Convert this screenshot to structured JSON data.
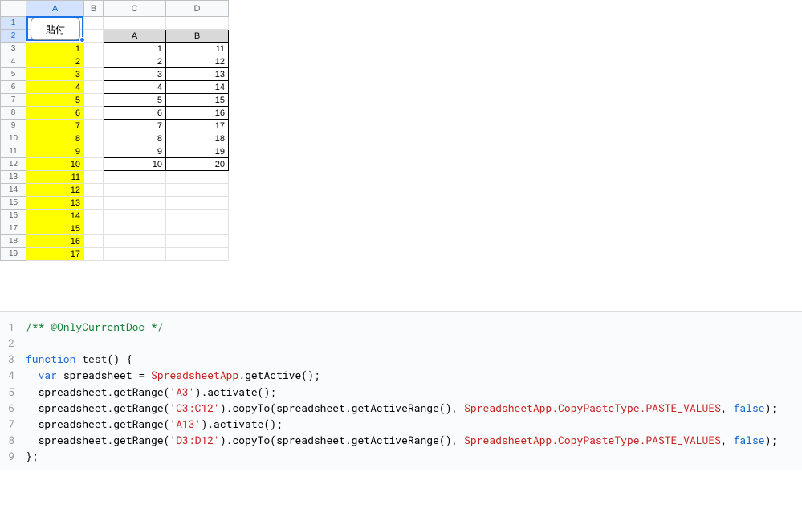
{
  "spreadsheet": {
    "button_label": "貼付",
    "column_headers": [
      "A",
      "B",
      "C",
      "D"
    ],
    "row_headers": [
      "1",
      "2",
      "3",
      "4",
      "5",
      "6",
      "7",
      "8",
      "9",
      "10",
      "11",
      "12",
      "13",
      "14",
      "15",
      "16",
      "17",
      "18",
      "19"
    ],
    "col_a_values": [
      "",
      "",
      "1",
      "2",
      "3",
      "4",
      "5",
      "6",
      "7",
      "8",
      "9",
      "10",
      "11",
      "12",
      "13",
      "14",
      "15",
      "16",
      "17"
    ],
    "inner_headers": [
      "A",
      "B"
    ],
    "inner_rows": [
      [
        "1",
        "11"
      ],
      [
        "2",
        "12"
      ],
      [
        "3",
        "13"
      ],
      [
        "4",
        "14"
      ],
      [
        "5",
        "15"
      ],
      [
        "6",
        "16"
      ],
      [
        "7",
        "17"
      ],
      [
        "8",
        "18"
      ],
      [
        "9",
        "19"
      ],
      [
        "10",
        "20"
      ]
    ]
  },
  "code": {
    "lines": [
      {
        "n": "1",
        "segments": [
          {
            "cls": "tok-comment",
            "t": "/** @OnlyCurrentDoc */"
          }
        ],
        "cursor": true
      },
      {
        "n": "2",
        "segments": []
      },
      {
        "n": "3",
        "segments": [
          {
            "cls": "tok-keyword",
            "t": "function"
          },
          {
            "cls": "",
            "t": " "
          },
          {
            "cls": "tok-func",
            "t": "test"
          },
          {
            "cls": "",
            "t": "() {"
          }
        ]
      },
      {
        "n": "4",
        "segments": [
          {
            "cls": "",
            "t": "  "
          },
          {
            "cls": "tok-keyword",
            "t": "var"
          },
          {
            "cls": "",
            "t": " spreadsheet = "
          },
          {
            "cls": "tok-class",
            "t": "SpreadsheetApp"
          },
          {
            "cls": "",
            "t": ".getActive();"
          }
        ]
      },
      {
        "n": "5",
        "segments": [
          {
            "cls": "",
            "t": "  spreadsheet.getRange("
          },
          {
            "cls": "tok-string",
            "t": "'A3'"
          },
          {
            "cls": "",
            "t": ").activate();"
          }
        ]
      },
      {
        "n": "6",
        "segments": [
          {
            "cls": "",
            "t": "  spreadsheet.getRange("
          },
          {
            "cls": "tok-string",
            "t": "'C3:C12'"
          },
          {
            "cls": "",
            "t": ").copyTo(spreadsheet.getActiveRange(), "
          },
          {
            "cls": "tok-enum",
            "t": "SpreadsheetApp.CopyPasteType.PASTE_VALUES"
          },
          {
            "cls": "",
            "t": ", "
          },
          {
            "cls": "tok-bool",
            "t": "false"
          },
          {
            "cls": "",
            "t": ");"
          }
        ]
      },
      {
        "n": "7",
        "segments": [
          {
            "cls": "",
            "t": "  spreadsheet.getRange("
          },
          {
            "cls": "tok-string",
            "t": "'A13'"
          },
          {
            "cls": "",
            "t": ").activate();"
          }
        ]
      },
      {
        "n": "8",
        "segments": [
          {
            "cls": "",
            "t": "  spreadsheet.getRange("
          },
          {
            "cls": "tok-string",
            "t": "'D3:D12'"
          },
          {
            "cls": "",
            "t": ").copyTo(spreadsheet.getActiveRange(), "
          },
          {
            "cls": "tok-enum",
            "t": "SpreadsheetApp.CopyPasteType.PASTE_VALUES"
          },
          {
            "cls": "",
            "t": ", "
          },
          {
            "cls": "tok-bool",
            "t": "false"
          },
          {
            "cls": "",
            "t": ");"
          }
        ]
      },
      {
        "n": "9",
        "segments": [
          {
            "cls": "",
            "t": "};"
          }
        ]
      }
    ]
  }
}
